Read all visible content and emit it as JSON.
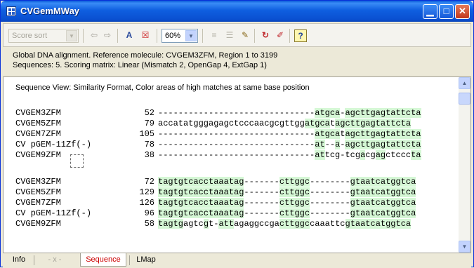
{
  "window": {
    "title": "CVGemMWay"
  },
  "toolbar": {
    "sort_combo": "Score sort",
    "zoom_combo": "60%",
    "help_label": "?"
  },
  "info": {
    "line1": "Global DNA alignment.   Reference molecule:  CVGEM3ZFM,  Region  1 to 3199",
    "line2": "Sequences: 5.   Scoring matrix: Linear (Mismatch 2, OpenGap 4, ExtGap 1)"
  },
  "content": {
    "view_label": "Sequence View:  Similarity Format, Color areas of high matches at same base position",
    "blocks": [
      {
        "rows": [
          {
            "name": "CVGEM3ZFM",
            "pos": "52",
            "seq": "-------------------------------atgca-agcttgagtattcta"
          },
          {
            "name": "CVGEM5ZFM",
            "pos": "79",
            "seq": "accatatgggagagctcccaacgcgttggatgcatagcttgagtattcta"
          },
          {
            "name": "CVGEM7ZFM",
            "pos": "105",
            "seq": "-------------------------------atgcatagcttgagtattcta"
          },
          {
            "name": "CV pGEM-11Zf(-)",
            "pos": "78",
            "seq": "-------------------------------at--a-agcttgagtattcta"
          },
          {
            "name": "CVGEM9ZFM",
            "pos": "38",
            "seq": "-------------------------------attcg-tcgacgagctcccta"
          }
        ]
      },
      {
        "rows": [
          {
            "name": "CVGEM3ZFM",
            "pos": "72",
            "seq": "tagtgtcacctaaatag-------cttggc--------gtaatcatggtca"
          },
          {
            "name": "CVGEM5ZFM",
            "pos": "129",
            "seq": "tagtgtcacctaaatag-------cttggc--------gtaatcatggtca"
          },
          {
            "name": "CVGEM7ZFM",
            "pos": "126",
            "seq": "tagtgtcacctaaatag-------cttggc--------gtaatcatggtca"
          },
          {
            "name": "CV pGEM-11Zf(-)",
            "pos": "96",
            "seq": "tagtgtcacctaaatag-------cttggc--------gtaatcatggtca"
          },
          {
            "name": "CVGEM9ZFM",
            "pos": "58",
            "seq": "tagtgagtcgt-attagaggccgacttggccaaattcgtaatcatggtca"
          }
        ]
      }
    ]
  },
  "tabs": [
    "Info",
    "- x -",
    "Sequence",
    "LMap"
  ],
  "active_tab": "Sequence",
  "colors": {
    "highlight": "#d5f7d5",
    "active_tab": "#cc0000",
    "titlebar": "#0a5bd8"
  }
}
